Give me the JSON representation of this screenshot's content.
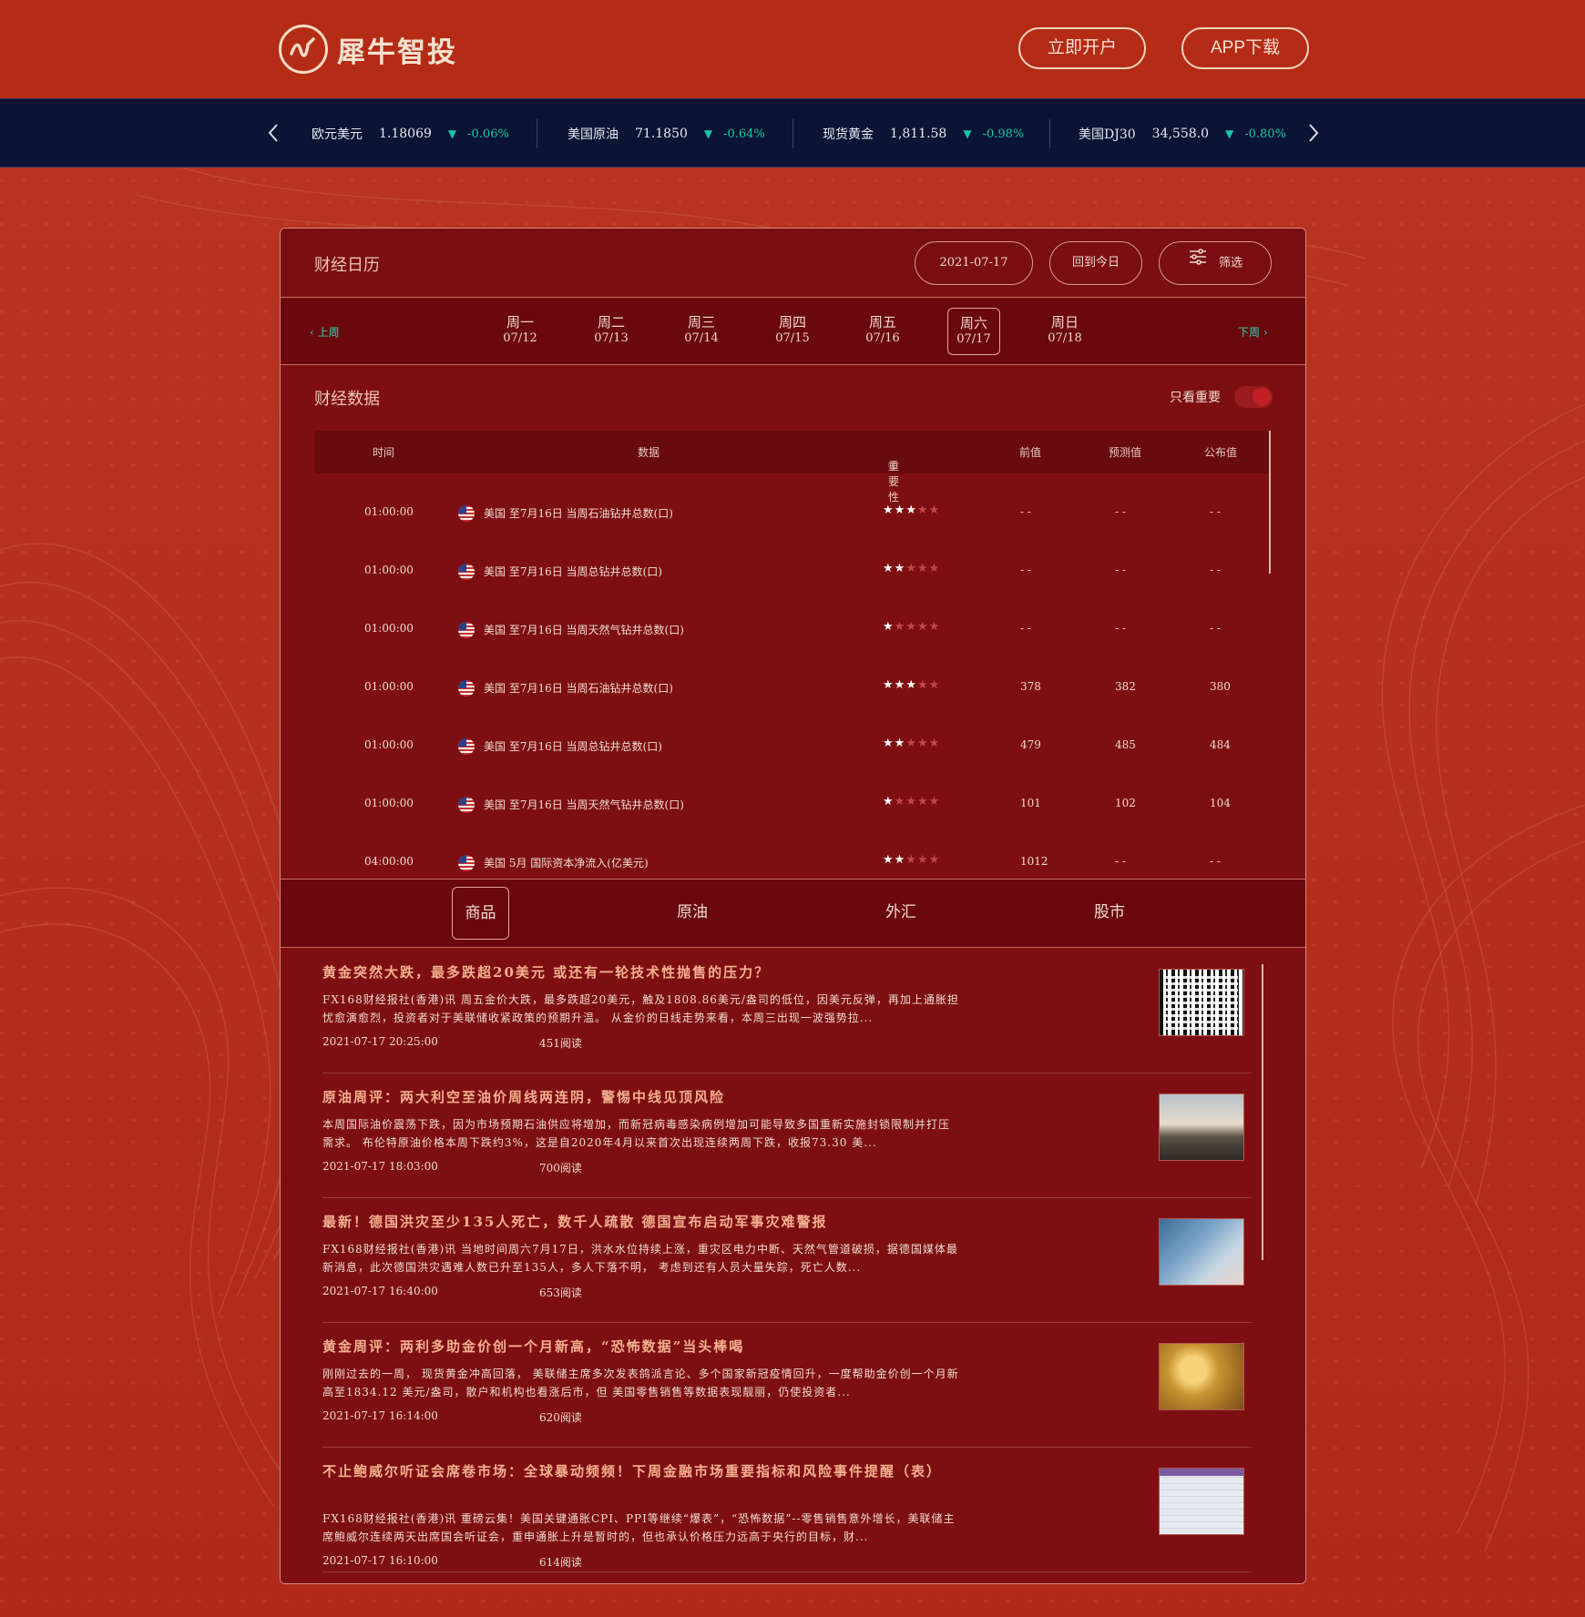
{
  "brand": {
    "name": "犀牛智投"
  },
  "header": {
    "open_account": "立即开户",
    "app_download": "APP下载"
  },
  "ticker": [
    {
      "name": "欧元美元",
      "price": "1.18069",
      "change": "-0.06%",
      "direction": "down"
    },
    {
      "name": "美国原油",
      "price": "71.1850",
      "change": "-0.64%",
      "direction": "down"
    },
    {
      "name": "现货黄金",
      "price": "1,811.58",
      "change": "-0.98%",
      "direction": "down"
    },
    {
      "name": "美国DJ30",
      "price": "34,558.0",
      "change": "-0.80%",
      "direction": "down"
    }
  ],
  "calendar": {
    "title": "财经日历",
    "date": "2021-07-17",
    "today_label": "回到今日",
    "filter_label": "筛选",
    "prev_week": "上周",
    "next_week": "下周",
    "days": [
      {
        "name": "周一",
        "date": "07/12",
        "active": false
      },
      {
        "name": "周二",
        "date": "07/13",
        "active": false
      },
      {
        "name": "周三",
        "date": "07/14",
        "active": false
      },
      {
        "name": "周四",
        "date": "07/15",
        "active": false
      },
      {
        "name": "周五",
        "date": "07/16",
        "active": false
      },
      {
        "name": "周六",
        "date": "07/17",
        "active": true
      },
      {
        "name": "周日",
        "date": "07/18",
        "active": false
      }
    ]
  },
  "data_section": {
    "title": "财经数据",
    "important_only": "只看重要",
    "columns": {
      "time": "时间",
      "data": "数据",
      "importance": "重要性",
      "previous": "前值",
      "forecast": "预测值",
      "actual": "公布值"
    },
    "rows": [
      {
        "time": "01:00:00",
        "event": "美国 至7月16日 当周石油钻井总数(口)",
        "stars": 3,
        "previous": "- -",
        "forecast": "- -",
        "actual": "- -"
      },
      {
        "time": "01:00:00",
        "event": "美国 至7月16日 当周总钻井总数(口)",
        "stars": 2,
        "previous": "- -",
        "forecast": "- -",
        "actual": "- -"
      },
      {
        "time": "01:00:00",
        "event": "美国 至7月16日 当周天然气钻井总数(口)",
        "stars": 1,
        "previous": "- -",
        "forecast": "- -",
        "actual": "- -"
      },
      {
        "time": "01:00:00",
        "event": "美国 至7月16日 当周石油钻井总数(口)",
        "stars": 3,
        "previous": "378",
        "forecast": "382",
        "actual": "380"
      },
      {
        "time": "01:00:00",
        "event": "美国 至7月16日 当周总钻井总数(口)",
        "stars": 2,
        "previous": "479",
        "forecast": "485",
        "actual": "484"
      },
      {
        "time": "01:00:00",
        "event": "美国 至7月16日 当周天然气钻井总数(口)",
        "stars": 1,
        "previous": "101",
        "forecast": "102",
        "actual": "104"
      },
      {
        "time": "04:00:00",
        "event": "美国 5月 国际资本净流入(亿美元)",
        "stars": 2,
        "previous": "1012",
        "forecast": "- -",
        "actual": "- -"
      }
    ]
  },
  "news_tabs": [
    "商品",
    "原油",
    "外汇",
    "股市"
  ],
  "news": [
    {
      "title": "黄金突然大跌，最多跌超20美元 或还有一轮技术性抛售的压力？",
      "body": "FX168财经报社(香港)讯 周五金价大跌，最多跌超20美元，触及1808.86美元/盎司的低位，因美元反弹，再加上通胀担忧愈演愈烈，投资者对于美联储收紧政策的预期升温。 从金价的日线走势来看，本周三出现一波强势拉...",
      "time": "2021-07-17 20:25:00",
      "reads": "451阅读",
      "thumb": "th-qr"
    },
    {
      "title": "原油周评：两大利空至油价周线两连阴，警惕中线见顶风险",
      "body": "本周国际油价震荡下跌，因为市场预期石油供应将增加，而新冠病毒感染病例增加可能导致多国重新实施封锁限制并打压需求。 布伦特原油价格本周下跌约3%，这是自2020年4月以来首次出现连续两周下跌，收报73.30 美...",
      "time": "2021-07-17 18:03:00",
      "reads": "700阅读",
      "thumb": "th-oil"
    },
    {
      "title": "最新！德国洪灾至少135人死亡，数千人疏散 德国宣布启动军事灾难警报",
      "body": "FX168财经报社(香港)讯 当地时间周六7月17日，洪水水位持续上涨，重灾区电力中断、天然气管道破损，据德国媒体最新消息，此次德国洪灾遇难人数已升至135人，多人下落不明， 考虑到还有人员大量失踪，死亡人数...",
      "time": "2021-07-17 16:40:00",
      "reads": "653阅读",
      "thumb": "th-flood"
    },
    {
      "title": "黄金周评：两利多助金价创一个月新高，“恐怖数据”当头棒喝",
      "body": "刚刚过去的一周， 现货黄金冲高回落， 美联储主席多次发表鸽派言论、多个国家新冠疫情回升，一度帮助金价创一个月新高至1834.12 美元/盎司，散户和机构也看涨后市，但 美国零售销售等数据表现靓丽，仍使投资者...",
      "time": "2021-07-17 16:14:00",
      "reads": "620阅读",
      "thumb": "th-gold"
    },
    {
      "title": "不止鲍威尔听证会席卷市场：全球暴动频频！下周金融市场重要指标和风险事件提醒（表）",
      "body": "FX168财经报社(香港)讯 重磅云集！美国关键通胀CPI、PPI等继续“爆表”，“恐怖数据”--零售销售意外增长，美联储主席鲍威尔连续两天出席国会听证会，重申通胀上升是暂时的，但也承认价格压力远高于央行的目标，财...",
      "time": "2021-07-17 16:10:00",
      "reads": "614阅读",
      "thumb": "th-table"
    }
  ]
}
